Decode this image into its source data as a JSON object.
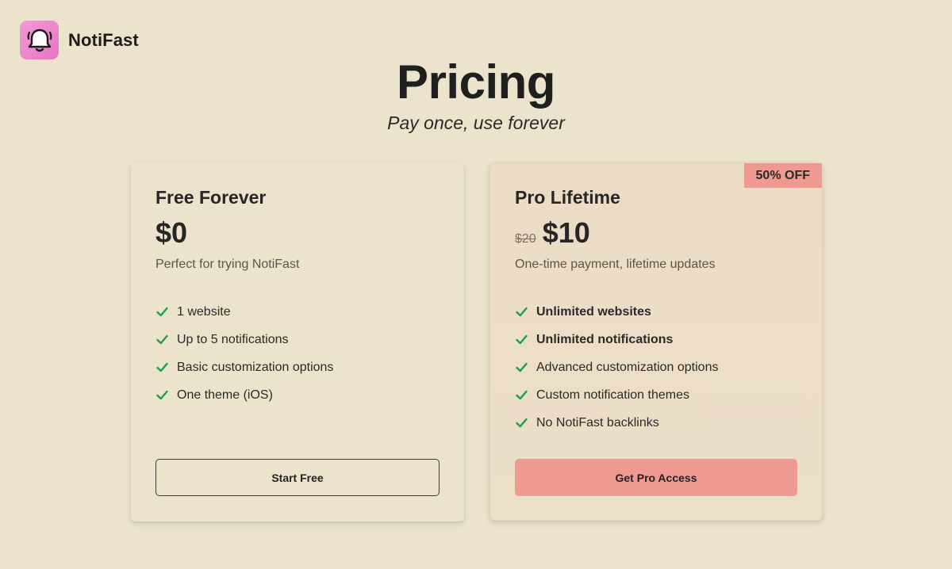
{
  "brand": {
    "name": "NotiFast",
    "logo_icon": "bell-icon",
    "logo_color": "#ec84c9"
  },
  "hero": {
    "title": "Pricing",
    "subtitle": "Pay once, use forever"
  },
  "plans": [
    {
      "name": "Free Forever",
      "price": "$0",
      "description": "Perfect for trying NotiFast",
      "features": [
        {
          "text": "1 website",
          "bold": false
        },
        {
          "text": "Up to 5 notifications",
          "bold": false
        },
        {
          "text": "Basic customization options",
          "bold": false
        },
        {
          "text": "One theme (iOS)",
          "bold": false
        }
      ],
      "cta": "Start Free"
    },
    {
      "name": "Pro Lifetime",
      "old_price": "$20",
      "price": "$10",
      "badge": "50% OFF",
      "description": "One-time payment, lifetime updates",
      "features": [
        {
          "text": "Unlimited websites",
          "bold": true
        },
        {
          "text": "Unlimited notifications",
          "bold": true
        },
        {
          "text": "Advanced customization options",
          "bold": false
        },
        {
          "text": "Custom notification themes",
          "bold": false
        },
        {
          "text": "No NotiFast backlinks",
          "bold": false
        }
      ],
      "cta": "Get Pro Access"
    }
  ],
  "colors": {
    "background": "#ebe3cb",
    "accent": "#ee9a92",
    "check": "#1f9d4c",
    "text": "#1f1f1f"
  }
}
